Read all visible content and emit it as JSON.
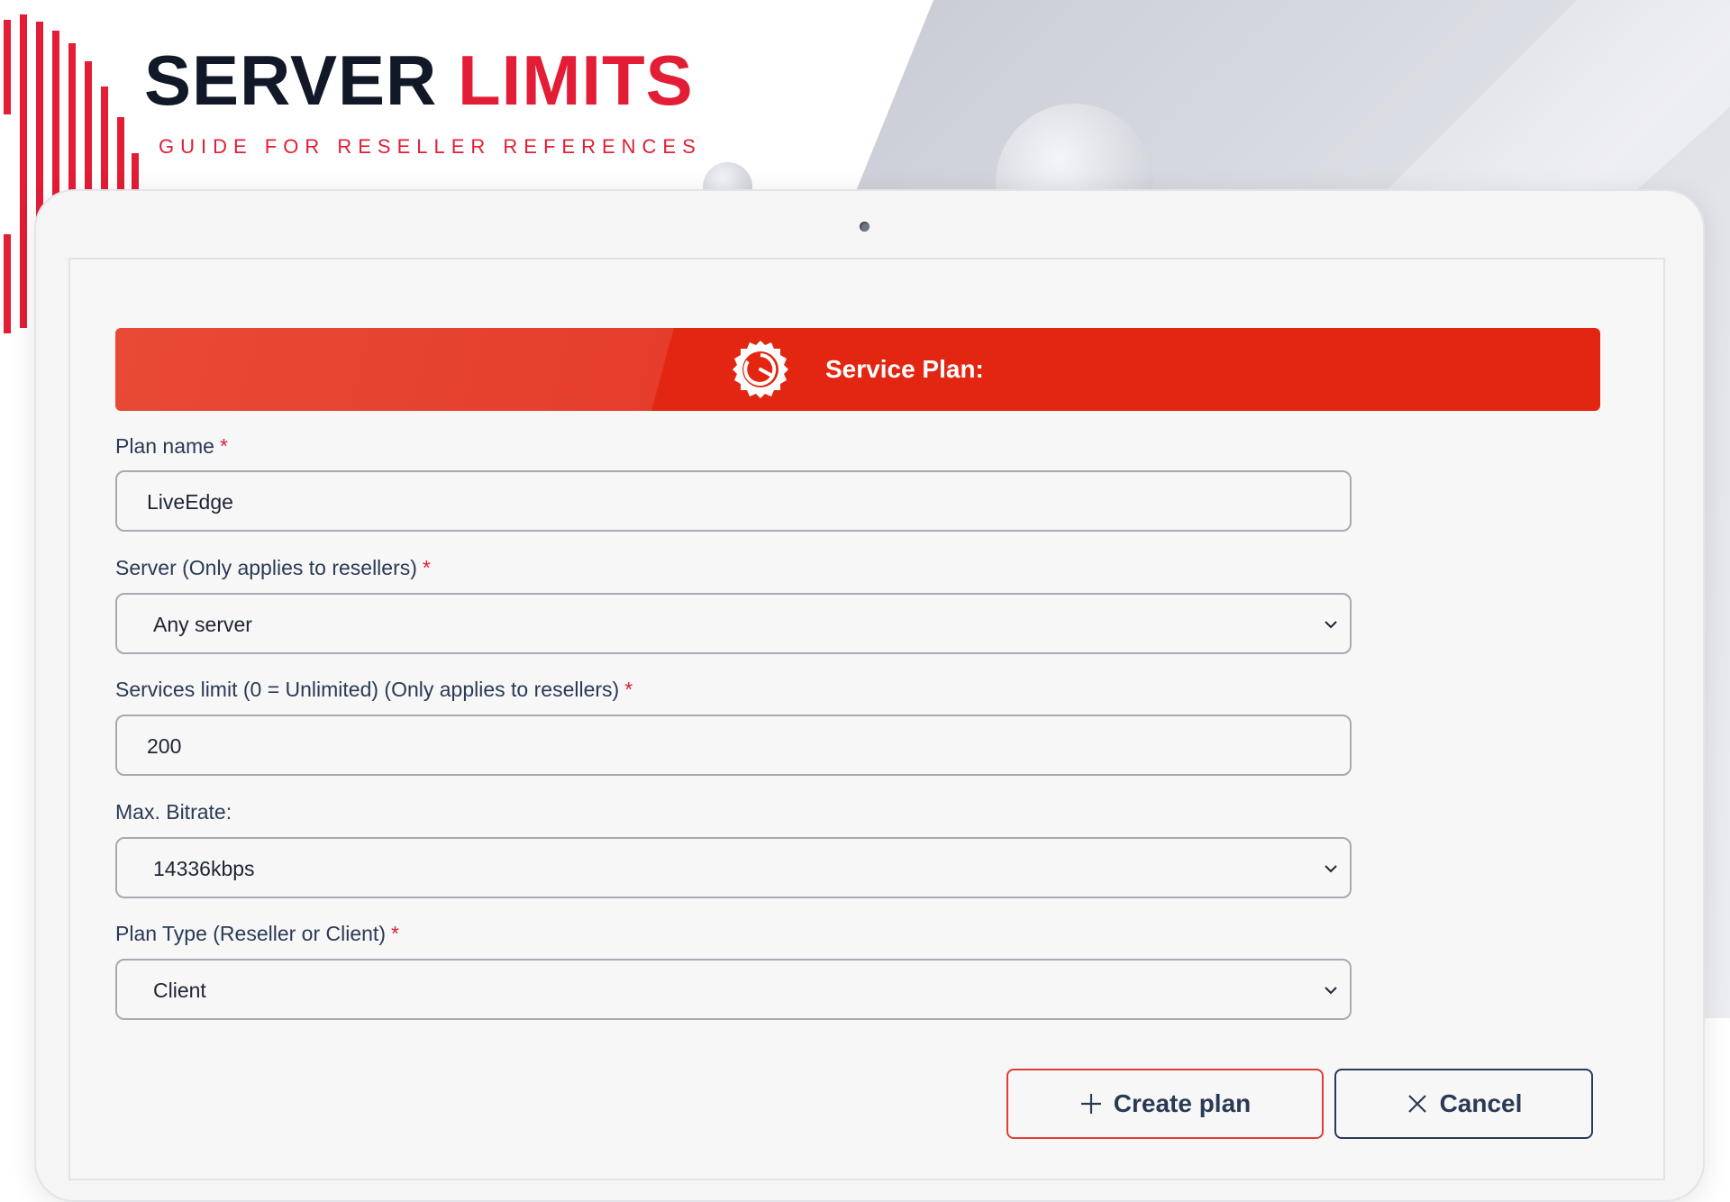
{
  "brand": {
    "title_main": "SERVER",
    "title_accent": "LIMITS",
    "subtitle": "GUIDE FOR RESELLER REFERENCES"
  },
  "form": {
    "header": {
      "title": "Service Plan:",
      "icon": "gauge-badge-icon"
    },
    "fields": {
      "plan_name": {
        "label": "Plan name",
        "required": "*",
        "value": "LiveEdge"
      },
      "server": {
        "label": "Server (Only applies to resellers)",
        "required": "*",
        "value": "Any server",
        "icon": "chevron-down-icon"
      },
      "services_limit": {
        "label": "Services limit (0 = Unlimited) (Only applies to resellers)",
        "required": "*",
        "value": "200"
      },
      "max_bitrate": {
        "label": "Max. Bitrate:",
        "value": "14336kbps",
        "icon": "chevron-down-icon"
      },
      "plan_type": {
        "label": "Plan Type (Reseller or Client)",
        "required": "*",
        "value": "Client",
        "icon": "chevron-down-icon"
      }
    },
    "buttons": {
      "create": {
        "label": "Create plan",
        "icon": "plus-icon"
      },
      "cancel": {
        "label": "Cancel",
        "icon": "close-icon"
      }
    }
  },
  "colors": {
    "accent_red": "#e21d35",
    "header_red": "#e22611",
    "text_navy": "#2a3a55",
    "dark_title": "#111827"
  }
}
